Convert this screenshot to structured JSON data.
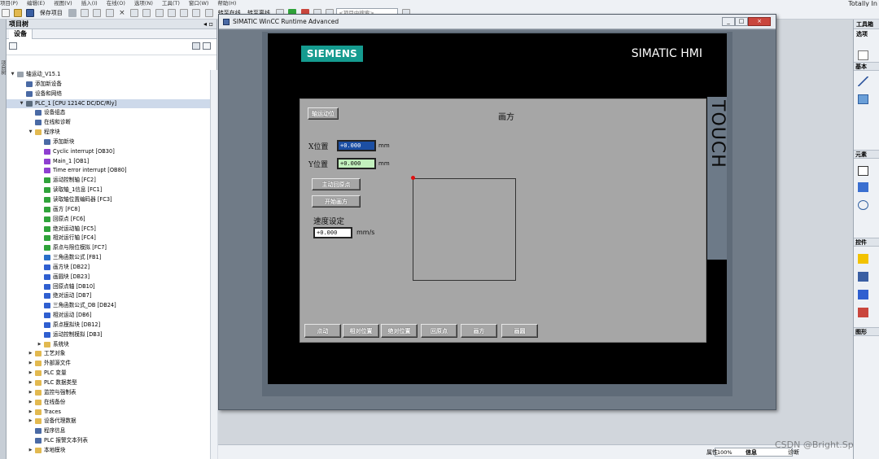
{
  "menu": [
    "项目(P)",
    "编辑(E)",
    "视图(V)",
    "插入(I)",
    "在线(O)",
    "选项(N)",
    "工具(T)",
    "窗口(W)",
    "帮助(H)"
  ],
  "brand": "Totally In",
  "toolbar": {
    "save_project": "保存项目",
    "go_online": "转至在线",
    "go_offline": "转至离线",
    "search_placeholder": "<项目中搜索>"
  },
  "project_tree": {
    "title": "项目树",
    "tab": "设备",
    "rows": [
      {
        "label": "轴运动_V15.1",
        "level": 0,
        "expanded": true,
        "icon": "project",
        "color": "#9aa3ad"
      },
      {
        "label": "添加新设备",
        "level": 1,
        "icon": "add-device",
        "color": "#4a6aa5"
      },
      {
        "label": "设备和网络",
        "level": 1,
        "icon": "network",
        "color": "#4a6aa5"
      },
      {
        "label": "PLC_1 [CPU 1214C DC/DC/Rly]",
        "level": 1,
        "expanded": true,
        "icon": "plc",
        "color": "#5b6b7c",
        "selected": true
      },
      {
        "label": "设备组态",
        "level": 2,
        "icon": "config",
        "color": "#4a6aa5"
      },
      {
        "label": "在线和诊断",
        "level": 2,
        "icon": "diagnostics",
        "color": "#4a6aa5"
      },
      {
        "label": "程序块",
        "level": 2,
        "expanded": true,
        "icon": "folder",
        "color": "#e2b950"
      },
      {
        "label": "添加新块",
        "level": 3,
        "icon": "add-block",
        "color": "#4a6aa5"
      },
      {
        "label": "Cyclic interrupt [OB30]",
        "level": 3,
        "icon": "ob",
        "color": "#8e3fd0"
      },
      {
        "label": "Main_1 [OB1]",
        "level": 3,
        "icon": "ob",
        "color": "#8e3fd0"
      },
      {
        "label": "Time error interrupt [OB80]",
        "level": 3,
        "icon": "ob",
        "color": "#8e3fd0"
      },
      {
        "label": "运动控制轴 [FC2]",
        "level": 3,
        "icon": "fc",
        "color": "#2fa33a"
      },
      {
        "label": "读取轴_1信息 [FC1]",
        "level": 3,
        "icon": "fc",
        "color": "#2fa33a"
      },
      {
        "label": "读取轴位置编码器 [FC3]",
        "level": 3,
        "icon": "fc",
        "color": "#2fa33a"
      },
      {
        "label": "画方 [FC8]",
        "level": 3,
        "icon": "fc",
        "color": "#2fa33a"
      },
      {
        "label": "回原点 [FC6]",
        "level": 3,
        "icon": "fc",
        "color": "#2fa33a"
      },
      {
        "label": "绝对运动轴 [FC5]",
        "level": 3,
        "icon": "fc",
        "color": "#2fa33a"
      },
      {
        "label": "相对运行轴 [FC4]",
        "level": 3,
        "icon": "fc",
        "color": "#2fa33a"
      },
      {
        "label": "原点与限位模拟 [FC7]",
        "level": 3,
        "icon": "fc",
        "color": "#2fa33a"
      },
      {
        "label": "三角函数公式 [FB1]",
        "level": 3,
        "icon": "fb",
        "color": "#2a6fc9"
      },
      {
        "label": "画方块 [DB22]",
        "level": 3,
        "icon": "db",
        "color": "#2f5fd0"
      },
      {
        "label": "画圆块 [DB23]",
        "level": 3,
        "icon": "db",
        "color": "#2f5fd0"
      },
      {
        "label": "回原点轴 [DB10]",
        "level": 3,
        "icon": "db",
        "color": "#2f5fd0"
      },
      {
        "label": "绝对运动 [DB7]",
        "level": 3,
        "icon": "db",
        "color": "#2f5fd0"
      },
      {
        "label": "三角函数公式_DB [DB24]",
        "level": 3,
        "icon": "db",
        "color": "#2f5fd0"
      },
      {
        "label": "相对运动 [DB6]",
        "level": 3,
        "icon": "db",
        "color": "#2f5fd0"
      },
      {
        "label": "原点模拟块 [DB12]",
        "level": 3,
        "icon": "db",
        "color": "#2f5fd0"
      },
      {
        "label": "运动控制模拟 [DB3]",
        "level": 3,
        "icon": "db",
        "color": "#2f5fd0"
      },
      {
        "label": "系统块",
        "level": 3,
        "collapsed": true,
        "icon": "folder",
        "color": "#e2b950"
      },
      {
        "label": "工艺对象",
        "level": 2,
        "collapsed": true,
        "icon": "folder",
        "color": "#e2b950"
      },
      {
        "label": "外部源文件",
        "level": 2,
        "collapsed": true,
        "icon": "folder",
        "color": "#e2b950"
      },
      {
        "label": "PLC 变量",
        "level": 2,
        "collapsed": true,
        "icon": "folder",
        "color": "#e2b950"
      },
      {
        "label": "PLC 数据类型",
        "level": 2,
        "collapsed": true,
        "icon": "folder",
        "color": "#e2b950"
      },
      {
        "label": "监控与强制表",
        "level": 2,
        "collapsed": true,
        "icon": "folder",
        "color": "#e2b950"
      },
      {
        "label": "在线备份",
        "level": 2,
        "collapsed": true,
        "icon": "folder",
        "color": "#e2b950"
      },
      {
        "label": "Traces",
        "level": 2,
        "collapsed": true,
        "icon": "folder",
        "color": "#e2b950"
      },
      {
        "label": "设备代理数据",
        "level": 2,
        "collapsed": true,
        "icon": "folder",
        "color": "#e2b950"
      },
      {
        "label": "程序信息",
        "level": 2,
        "icon": "info",
        "color": "#4a6aa5"
      },
      {
        "label": "PLC 报警文本列表",
        "level": 2,
        "icon": "alarm",
        "color": "#4a6aa5"
      },
      {
        "label": "本地模块",
        "level": 2,
        "collapsed": true,
        "icon": "folder",
        "color": "#e2b950"
      }
    ]
  },
  "right_panel": {
    "title": "工具箱",
    "options": "选项",
    "sections": [
      "基本",
      "元素",
      "控件",
      "图形"
    ]
  },
  "runtime_window": {
    "title": "SIMATIC WinCC Runtime Advanced",
    "min": "_",
    "max": "□",
    "close": "×",
    "brand_logo": "SIEMENS",
    "hmi_name": "SIMATIC HMI",
    "touch": "TOUCH",
    "screen": {
      "top_button": "轴运动位",
      "title": "画方",
      "x_label": "X位置",
      "x_value": "+0.000",
      "x_unit": "mm",
      "y_label": "Y位置",
      "y_value": "+0.000",
      "y_unit": "mm",
      "btn_home": "主动回原点",
      "btn_draw_square": "开始画方",
      "speed_label": "速度设定",
      "speed_value": "+0.000",
      "speed_unit": "mm/s",
      "nav": [
        "点动",
        "相对位置",
        "绝对位置",
        "回原点",
        "画方",
        "画圆"
      ]
    }
  },
  "statusbar": {
    "zoom": "100%",
    "properties": "属性",
    "info": "信息",
    "diagnostics": "诊断"
  },
  "colors": {
    "siemens_teal": "#159b8f",
    "hmi_screen": "#a6a6a6",
    "field_green": "#c2f0bd",
    "field_active": "#1c4fa3",
    "marker_red": "#e01010"
  },
  "watermark": "CSDN @Bright.Sp"
}
